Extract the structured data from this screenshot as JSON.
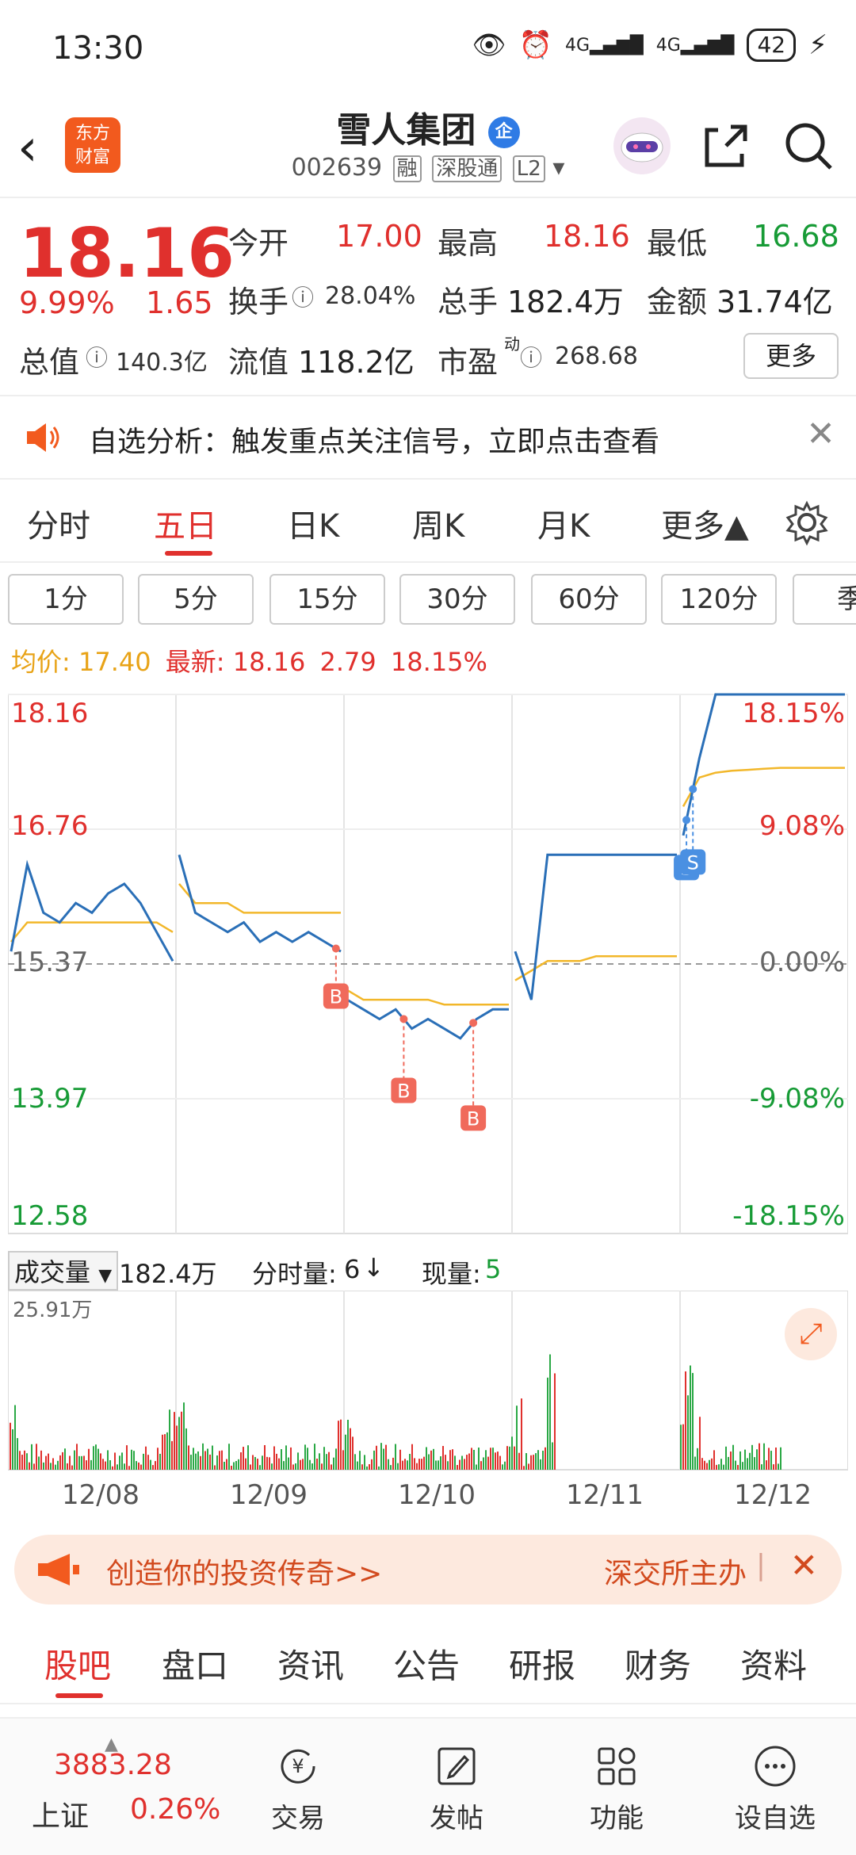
{
  "status": {
    "time": "13:30",
    "net1": "4G",
    "net2": "4G",
    "battery": "42"
  },
  "header": {
    "title": "雪人集团",
    "title_tag": "企",
    "code": "002639",
    "badges": [
      "融",
      "深股通",
      "L2"
    ],
    "logo_line1": "东方",
    "logo_line2": "财富"
  },
  "quote": {
    "price": "18.16",
    "pct": "9.99%",
    "change": "1.65",
    "open_label": "今开",
    "open": "17.00",
    "high_label": "最高",
    "high": "18.16",
    "low_label": "最低",
    "low": "16.68",
    "turnover_label": "换手",
    "turnover": "28.04%",
    "volume_label": "总手",
    "volume": "182.4万",
    "amount_label": "金额",
    "amount": "31.74亿",
    "mktcap_label": "总值",
    "mktcap": "140.3亿",
    "float_label": "流值",
    "float": "118.2亿",
    "pe_label": "市盈",
    "pe_sup": "动",
    "pe": "268.68",
    "more": "更多"
  },
  "notice": {
    "text": "自选分析：触发重点关注信号，立即点击查看"
  },
  "tabs": [
    "分时",
    "五日",
    "日K",
    "周K",
    "月K",
    "更多▲"
  ],
  "periods": [
    "1分",
    "5分",
    "15分",
    "30分",
    "60分",
    "120分",
    "季"
  ],
  "avg": {
    "label1": "均价:",
    "value1": "17.40",
    "label2": "最新:",
    "value2": "18.16",
    "value3": "2.79",
    "value4": "18.15%"
  },
  "chart_data": {
    "type": "line",
    "y_left_ticks": [
      "18.16",
      "16.76",
      "15.37",
      "13.97",
      "12.58"
    ],
    "y_right_ticks": [
      "18.15%",
      "9.08%",
      "0.00%",
      "-9.08%",
      "-18.15%"
    ],
    "x_days": [
      "12/08",
      "12/09",
      "12/10",
      "12/11",
      "12/12"
    ],
    "ylim": [
      12.58,
      18.16
    ],
    "base": 15.37,
    "price_series": [
      [
        15.5,
        16.4,
        15.9,
        15.8,
        16.0,
        15.9,
        16.1,
        16.2,
        16.0,
        15.7,
        15.4
      ],
      [
        16.5,
        15.9,
        15.8,
        15.7,
        15.8,
        15.6,
        15.7,
        15.6,
        15.7,
        15.6,
        15.5
      ],
      [
        15.0,
        14.9,
        14.8,
        14.9,
        14.7,
        14.8,
        14.7,
        14.6,
        14.8,
        14.9,
        14.9
      ],
      [
        15.5,
        15.0,
        16.5,
        16.5,
        16.5,
        16.5,
        16.5,
        16.5,
        16.5,
        16.5,
        16.5
      ],
      [
        16.7,
        17.5,
        18.16,
        18.16,
        18.16,
        18.16,
        18.16,
        18.16,
        18.16,
        18.16,
        18.16
      ]
    ],
    "avg_series": [
      [
        15.6,
        15.8,
        15.8,
        15.8,
        15.8,
        15.8,
        15.8,
        15.8,
        15.8,
        15.8,
        15.7
      ],
      [
        16.2,
        16.0,
        16.0,
        16.0,
        15.9,
        15.9,
        15.9,
        15.9,
        15.9,
        15.9,
        15.9
      ],
      [
        15.1,
        15.0,
        15.0,
        15.0,
        15.0,
        15.0,
        14.95,
        14.95,
        14.95,
        14.95,
        14.95
      ],
      [
        15.2,
        15.3,
        15.4,
        15.4,
        15.4,
        15.45,
        15.45,
        15.45,
        15.45,
        15.45,
        15.45
      ],
      [
        17.0,
        17.3,
        17.35,
        17.37,
        17.38,
        17.39,
        17.4,
        17.4,
        17.4,
        17.4,
        17.4
      ]
    ],
    "markers": [
      {
        "label": "B",
        "day": 1,
        "pos": 0.97
      },
      {
        "label": "B",
        "day": 2,
        "pos": 0.35
      },
      {
        "label": "B",
        "day": 2,
        "pos": 0.78
      },
      {
        "label": "S",
        "day": 4,
        "pos": 0.02
      },
      {
        "label": "S",
        "day": 4,
        "pos": 0.06
      }
    ]
  },
  "volume": {
    "label": "成交量",
    "total": "182.4万",
    "fenshi_label": "分时量:",
    "fenshi": "6",
    "xianliang_label": "现量:",
    "xianliang": "5",
    "max_label": "25.91万"
  },
  "banner": {
    "left": "创造你的投资传奇>>",
    "right": "深交所主办"
  },
  "bottom_tabs": [
    "股吧",
    "盘口",
    "资讯",
    "公告",
    "研报",
    "财务",
    "资料"
  ],
  "index": {
    "value": "3883.28",
    "name": "上证",
    "pct": "0.26%"
  },
  "nav": [
    "交易",
    "发帖",
    "功能",
    "设自选"
  ],
  "colors": {
    "up": "#e0302d",
    "down": "#179b36",
    "line": "#2a6fb7",
    "avg": "#f2b72a",
    "accent": "#f25a1e"
  }
}
